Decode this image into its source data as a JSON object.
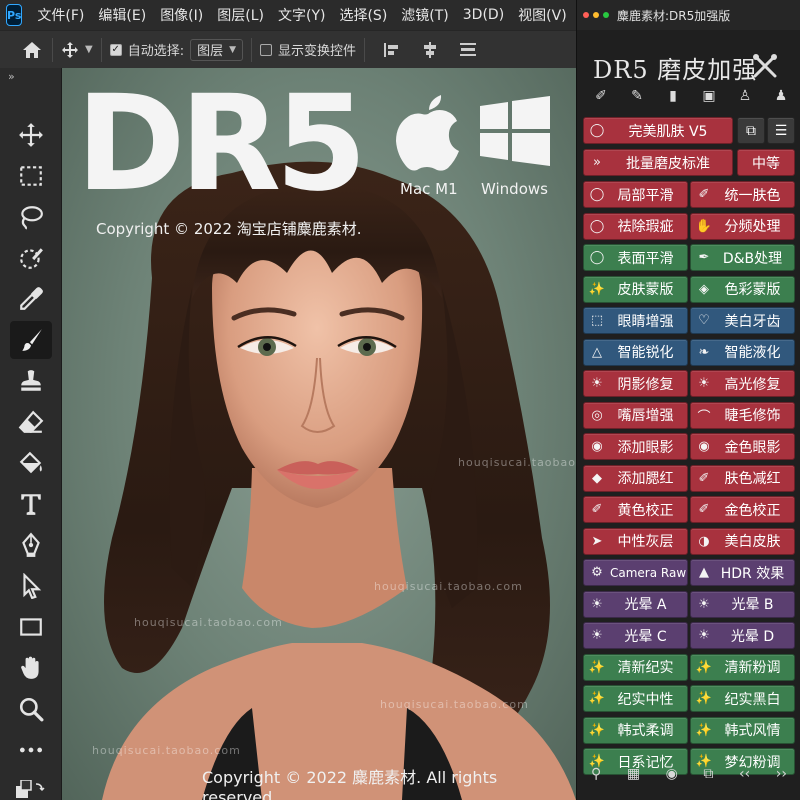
{
  "menubar": {
    "app_icon": "Ps",
    "items": [
      "文件(F)",
      "编辑(E)",
      "图像(I)",
      "图层(L)",
      "文字(Y)",
      "选择(S)",
      "滤镜(T)",
      "3D(D)",
      "视图(V)",
      "窗"
    ]
  },
  "options": {
    "auto_select_label": "自动选择:",
    "auto_select_value": "图层",
    "transform_label": "显示变换控件"
  },
  "toolbar": {
    "collapse": "»",
    "tools": [
      "move-icon",
      "marquee-icon",
      "lasso-icon",
      "quick-select-icon",
      "eyedropper-icon",
      "brush-icon",
      "stamp-icon",
      "eraser-icon",
      "paint-bucket-icon",
      "type-icon",
      "pen-icon",
      "path-select-icon",
      "rectangle-icon",
      "hand-icon",
      "zoom-icon",
      "more-icon"
    ],
    "selected": "brush-icon"
  },
  "canvas": {
    "headline": "DR5",
    "copyright_top": "Copyright © 2022 淘宝店铺麋鹿素材.",
    "mac_label": "Mac M1",
    "windows_label": "Windows",
    "watermark": "houqisucai.taobao.com",
    "copyright_bottom": "Copyright © 2022 麋鹿素材. All rights reserved."
  },
  "panel": {
    "window_title": "麋鹿素材:DR5加强版",
    "heading": "DR5 磨皮加强",
    "buttons": [
      {
        "label": "完美肌肤 V5",
        "color": "red",
        "icon": "lasso-icon"
      },
      {
        "label": "批量磨皮标准",
        "color": "red",
        "icon": "batch-icon"
      },
      {
        "label": "中等",
        "color": "red",
        "icon": ""
      },
      {
        "label": "局部平滑",
        "color": "red",
        "icon": "lasso-icon"
      },
      {
        "label": "统一肤色",
        "color": "red",
        "icon": "eyedropper-icon"
      },
      {
        "label": "祛除瑕疵",
        "color": "red",
        "icon": "lasso-icon"
      },
      {
        "label": "分频处理",
        "color": "red",
        "icon": "hand-icon"
      },
      {
        "label": "表面平滑",
        "color": "green",
        "icon": "lasso-icon"
      },
      {
        "label": "D&B处理",
        "color": "green",
        "icon": "brush-icon"
      },
      {
        "label": "皮肤蒙版",
        "color": "green",
        "icon": "wand-icon"
      },
      {
        "label": "色彩蒙版",
        "color": "green",
        "icon": "bucket-icon"
      },
      {
        "label": "眼睛增强",
        "color": "blue",
        "icon": "marquee-icon"
      },
      {
        "label": "美白牙齿",
        "color": "blue",
        "icon": "tooth-icon"
      },
      {
        "label": "智能锐化",
        "color": "blue",
        "icon": "triangle-icon"
      },
      {
        "label": "智能液化",
        "color": "blue",
        "icon": "liquify-icon"
      },
      {
        "label": "阴影修复",
        "color": "red",
        "icon": "sun-icon"
      },
      {
        "label": "高光修复",
        "color": "red",
        "icon": "sun-icon"
      },
      {
        "label": "嘴唇增强",
        "color": "red",
        "icon": "lips-icon"
      },
      {
        "label": "睫毛修饰",
        "color": "red",
        "icon": "lash-icon"
      },
      {
        "label": "添加眼影",
        "color": "red",
        "icon": "eye-icon"
      },
      {
        "label": "金色眼影",
        "color": "red",
        "icon": "eye-icon"
      },
      {
        "label": "添加腮红",
        "color": "red",
        "icon": "diamond-icon"
      },
      {
        "label": "肤色减红",
        "color": "red",
        "icon": "eyedropper-icon"
      },
      {
        "label": "黄色校正",
        "color": "red",
        "icon": "eyedropper-icon"
      },
      {
        "label": "金色校正",
        "color": "red",
        "icon": "eyedropper-icon"
      },
      {
        "label": "中性灰层",
        "color": "red",
        "icon": "cursor-icon"
      },
      {
        "label": "美白皮肤",
        "color": "red",
        "icon": "mask-icon"
      },
      {
        "label": "Camera Raw",
        "color": "purple",
        "icon": "gear-icon"
      },
      {
        "label": "HDR 效果",
        "color": "purple",
        "icon": "mountain-icon"
      },
      {
        "label": "光晕 A",
        "color": "purple",
        "icon": "sun-icon"
      },
      {
        "label": "光晕 B",
        "color": "purple",
        "icon": "sun-icon"
      },
      {
        "label": "光晕 C",
        "color": "purple",
        "icon": "sun-icon"
      },
      {
        "label": "光晕 D",
        "color": "purple",
        "icon": "sun-icon"
      },
      {
        "label": "清新纪实",
        "color": "green",
        "icon": "wand-icon"
      },
      {
        "label": "清新粉调",
        "color": "green",
        "icon": "wand-icon"
      },
      {
        "label": "纪实中性",
        "color": "green",
        "icon": "wand-icon"
      },
      {
        "label": "纪实黑白",
        "color": "green",
        "icon": "wand-icon"
      },
      {
        "label": "韩式柔调",
        "color": "green",
        "icon": "wand-icon"
      },
      {
        "label": "韩式风情",
        "color": "green",
        "icon": "wand-icon"
      },
      {
        "label": "日系记忆",
        "color": "green",
        "icon": "wand-icon"
      },
      {
        "label": "梦幻粉调",
        "color": "green",
        "icon": "wand-icon"
      }
    ],
    "bottom_icons": [
      "search-icon",
      "gallery-icon",
      "view-icon",
      "copy-icon",
      "prev-icon",
      "next-icon"
    ]
  },
  "colors": {
    "red": "#a8323e",
    "green": "#3c7f4f",
    "blue": "#31587d",
    "purple": "#5b3f70"
  }
}
